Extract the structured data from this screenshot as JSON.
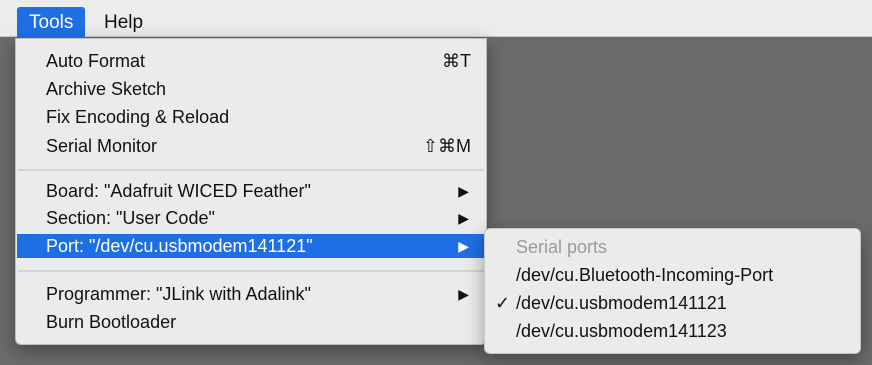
{
  "menubar": {
    "tools": "Tools",
    "help": "Help"
  },
  "tools_menu": {
    "auto_format": {
      "label": "Auto Format",
      "shortcut": "⌘T"
    },
    "archive_sketch": {
      "label": "Archive Sketch"
    },
    "fix_encoding": {
      "label": "Fix Encoding & Reload"
    },
    "serial_monitor": {
      "label": "Serial Monitor",
      "shortcut": "⇧⌘M"
    },
    "board": {
      "label": "Board: \"Adafruit WICED Feather\"",
      "arrow": "▶"
    },
    "section": {
      "label": "Section: \"User Code\"",
      "arrow": "▶"
    },
    "port": {
      "label": "Port: \"/dev/cu.usbmodem141121\"",
      "arrow": "▶"
    },
    "programmer": {
      "label": "Programmer: \"JLink with Adalink\"",
      "arrow": "▶"
    },
    "burn_bootloader": {
      "label": "Burn Bootloader"
    }
  },
  "port_submenu": {
    "header": "Serial ports",
    "items": [
      {
        "label": "/dev/cu.Bluetooth-Incoming-Port",
        "check": ""
      },
      {
        "label": "/dev/cu.usbmodem141121",
        "check": "✓"
      },
      {
        "label": "/dev/cu.usbmodem141123",
        "check": ""
      }
    ]
  },
  "colors": {
    "highlight": "#1f6fe4",
    "menu_bg": "#ebebeb",
    "backdrop": "#6b6b6b"
  }
}
